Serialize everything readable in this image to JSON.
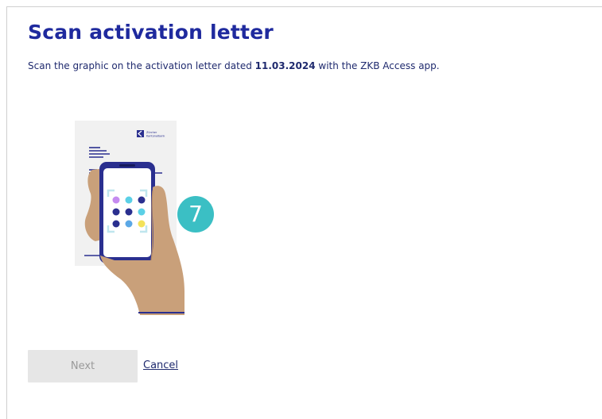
{
  "page": {
    "title": "Scan activation letter",
    "subtitle_prefix": "Scan the graphic on the activation letter dated ",
    "subtitle_date": "11.03.2024",
    "subtitle_suffix": " with the ZKB Access app."
  },
  "illustration": {
    "letter_brand_line1": "Zürcher",
    "letter_brand_line2": "Kantonalbank",
    "qr_dot_colors": [
      "#c58bf0",
      "#5bd0e6",
      "#2a2f8f",
      "#2a2f8f",
      "#2a2f8f",
      "#5bd0e6",
      "#2a2f8f",
      "#5ba8e6",
      "#f3e25a"
    ]
  },
  "step_badge": {
    "number": "7",
    "color": "#3bbfc4"
  },
  "actions": {
    "next_label": "Next",
    "cancel_label": "Cancel"
  },
  "colors": {
    "heading": "#1f2a9e",
    "text": "#1f2a6e",
    "button_disabled_bg": "#e6e6e6",
    "button_disabled_text": "#9a9a9a"
  }
}
